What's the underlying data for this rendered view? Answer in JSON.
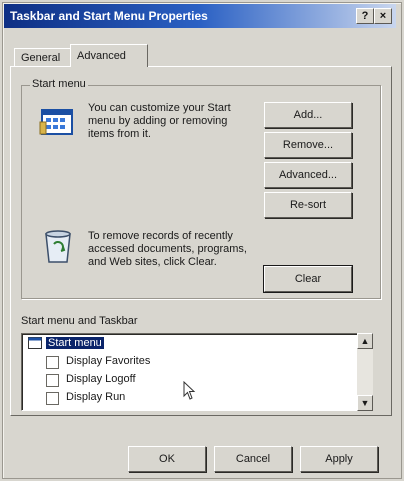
{
  "window": {
    "title": "Taskbar and Start Menu Properties",
    "help_label": "?",
    "close_label": "×"
  },
  "tabs": [
    {
      "label": "General"
    },
    {
      "label": "Advanced"
    }
  ],
  "start_menu": {
    "group_label": "Start menu",
    "description": "You can customize your Start menu by adding or removing items from it.",
    "buttons": {
      "add": "Add...",
      "remove": "Remove...",
      "advanced": "Advanced...",
      "resort": "Re-sort"
    },
    "clear_description": "To remove records of recently accessed documents, programs, and Web sites, click Clear.",
    "clear_button": "Clear"
  },
  "start_menu_taskbar": {
    "group_label": "Start menu and Taskbar",
    "items": [
      {
        "label": "Start menu",
        "selected": true
      },
      {
        "label": "Display Favorites",
        "checked": false
      },
      {
        "label": "Display Logoff",
        "checked": false
      },
      {
        "label": "Display Run",
        "checked": false
      }
    ]
  },
  "dialog_buttons": {
    "ok": "OK",
    "cancel": "Cancel",
    "apply": "Apply"
  }
}
